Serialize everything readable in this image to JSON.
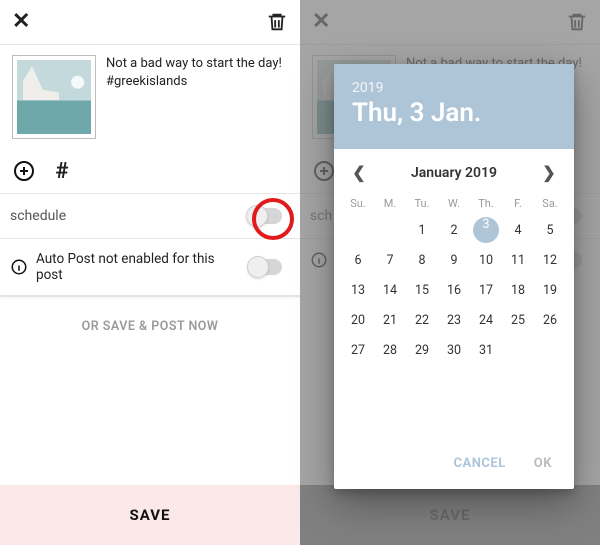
{
  "left": {
    "caption": "Not a bad way to start the day! #greekislands",
    "schedule_label": "schedule",
    "autopost_label": "Auto Post not enabled for this post",
    "or_save_label": "OR SAVE & POST NOW",
    "save_label": "SAVE"
  },
  "right": {
    "save_label": "SAVE",
    "sched_abbrev": "sch"
  },
  "picker": {
    "year": "2019",
    "headline": "Thu, 3 Jan.",
    "month_label": "January 2019",
    "dow": [
      "Su.",
      "M.",
      "Tu.",
      "W.",
      "Th.",
      "F.",
      "Sa."
    ],
    "offset": 2,
    "days_in_month": 31,
    "selected_day": 3,
    "cancel": "CANCEL",
    "ok": "OK"
  }
}
